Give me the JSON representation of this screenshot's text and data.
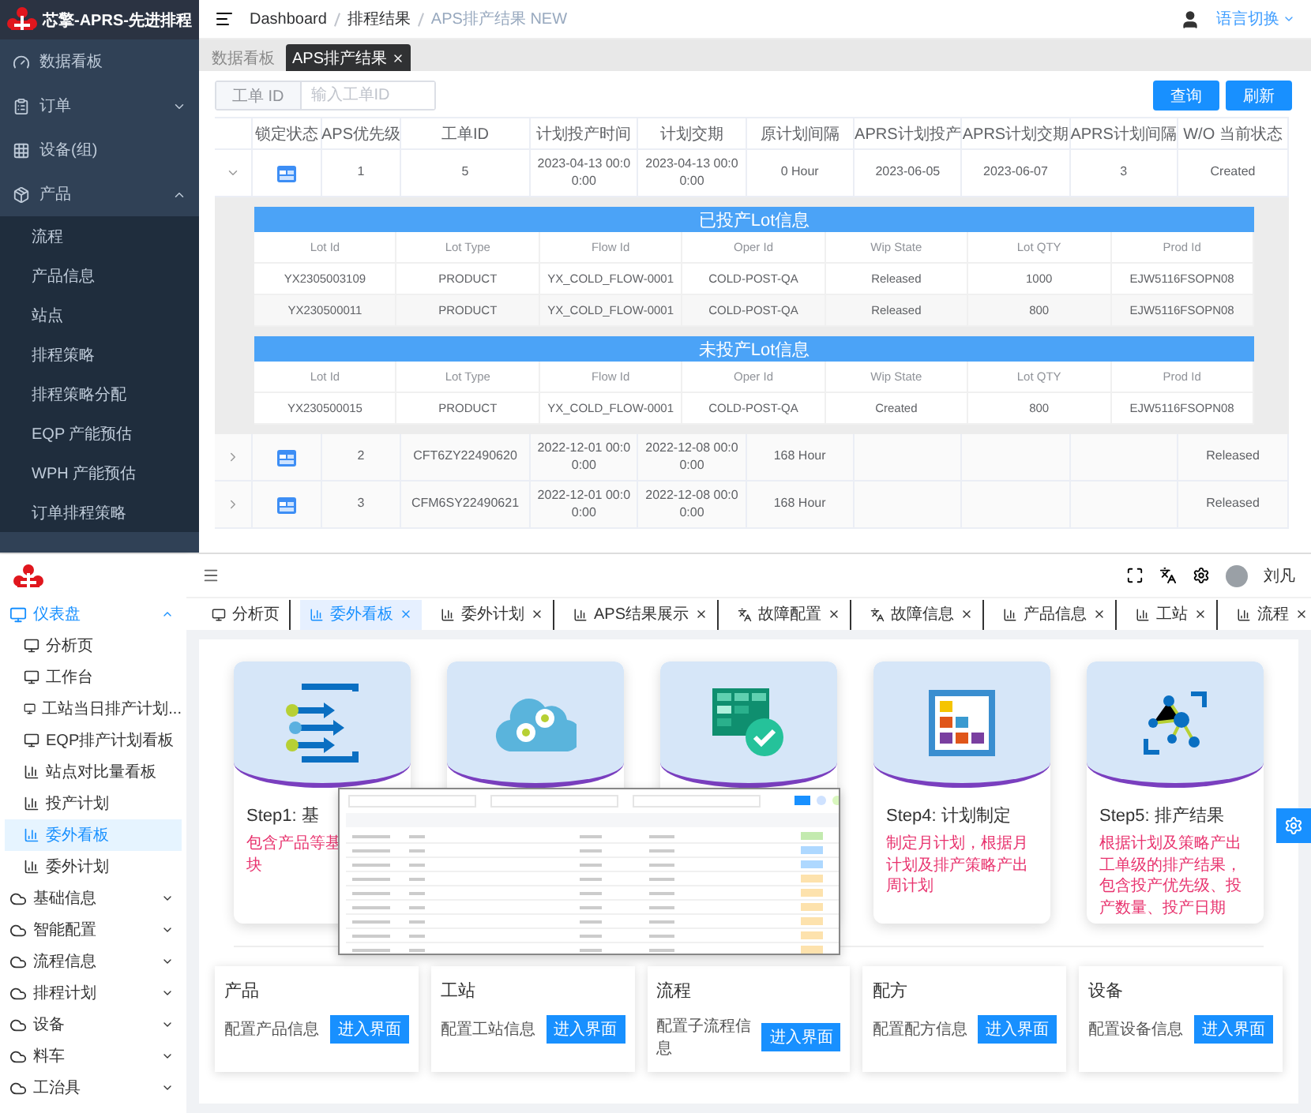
{
  "admin": {
    "app_title": "芯擎-APRS-先进排程",
    "sidebar": [
      {
        "label": "数据看板",
        "kind": "link"
      },
      {
        "label": "订单",
        "kind": "group",
        "expanded": false
      },
      {
        "label": "设备(组)",
        "kind": "link"
      },
      {
        "label": "产品",
        "kind": "group",
        "expanded": true,
        "children": [
          {
            "label": "流程"
          },
          {
            "label": "产品信息"
          },
          {
            "label": "站点"
          },
          {
            "label": "排程策略"
          },
          {
            "label": "排程策略分配"
          },
          {
            "label": "EQP 产能预估"
          },
          {
            "label": "WPH 产能预估"
          },
          {
            "label": "订单排程策略"
          }
        ]
      }
    ],
    "breadcrumb": [
      "Dashboard",
      "排程结果",
      "APS排产结果 NEW"
    ],
    "language": {
      "label": "语言切换",
      "expanded": false
    },
    "tags": [
      {
        "label": "数据看板",
        "selected": false,
        "closable": false
      },
      {
        "label": "APS排产结果",
        "selected": true,
        "closable": true
      }
    ],
    "filter": {
      "label": "工单 ID",
      "placeholder": "输入工单ID"
    },
    "buttons": [
      "查询",
      "刷新"
    ],
    "table": {
      "columns": [
        "锁定状态",
        "APS优先级",
        "工单ID",
        "计划投产时间",
        "计划交期",
        "原计划间隔",
        "APRS计划投产",
        "APRS计划交期",
        "APRS计划间隔",
        "W/O 当前状态"
      ],
      "rows": [
        {
          "expanded": true,
          "cells": [
            null,
            "1",
            "5",
            "2023-04-13 00:00:00",
            "2023-04-13 00:00:00",
            "0 Hour",
            "2023-06-05",
            "2023-06-07",
            "3",
            "Created"
          ],
          "details": [
            {
              "title": "已投产Lot信息",
              "columns": [
                "Lot Id",
                "Lot Type",
                "Flow Id",
                "Oper Id",
                "Wip State",
                "Lot QTY",
                "Prod Id"
              ],
              "rows": [
                [
                  "YX2305003109",
                  "PRODUCT",
                  "YX_COLD_FLOW-0001",
                  "COLD-POST-QA",
                  "Released",
                  "1000",
                  "EJW5116FSOPN08"
                ],
                [
                  "YX230500011",
                  "PRODUCT",
                  "YX_COLD_FLOW-0001",
                  "COLD-POST-QA",
                  "Released",
                  "800",
                  "EJW5116FSOPN08"
                ]
              ]
            },
            {
              "title": "未投产Lot信息",
              "columns": [
                "Lot Id",
                "Lot Type",
                "Flow Id",
                "Oper Id",
                "Wip State",
                "Lot QTY",
                "Prod Id"
              ],
              "rows": [
                [
                  "YX230500015",
                  "PRODUCT",
                  "YX_COLD_FLOW-0001",
                  "COLD-POST-QA",
                  "Created",
                  "800",
                  "EJW5116FSOPN08"
                ]
              ]
            }
          ]
        },
        {
          "expanded": false,
          "cells": [
            null,
            "2",
            "CFT6ZY22490620",
            "2022-12-01 00:00:00",
            "2022-12-08 00:00:00",
            "168 Hour",
            null,
            null,
            null,
            "Released"
          ]
        },
        {
          "expanded": false,
          "cells": [
            null,
            "3",
            "CFM6SY22490621",
            "2022-12-01 00:00:00",
            "2022-12-08 00:00:00",
            "168 Hour",
            null,
            null,
            null,
            "Released"
          ]
        }
      ]
    }
  },
  "mes": {
    "user": "刘凡",
    "sidebar": [
      {
        "label": "仪表盘",
        "expanded": true,
        "children": [
          {
            "label": "分析页",
            "selected": false
          },
          {
            "label": "工作台",
            "selected": false
          },
          {
            "label": "工站当日排产计划...",
            "selected": false
          },
          {
            "label": "EQP排产计划看板",
            "selected": false
          },
          {
            "label": "站点对比量看板",
            "selected": false
          },
          {
            "label": "投产计划",
            "selected": false
          },
          {
            "label": "委外看板",
            "selected": true
          },
          {
            "label": "委外计划",
            "selected": false
          }
        ]
      },
      {
        "label": "基础信息",
        "expanded": false
      },
      {
        "label": "智能配置",
        "expanded": false
      },
      {
        "label": "流程信息",
        "expanded": false
      },
      {
        "label": "排程计划",
        "expanded": false
      },
      {
        "label": "设备",
        "expanded": false
      },
      {
        "label": "料车",
        "expanded": false
      },
      {
        "label": "工治具",
        "expanded": false
      }
    ],
    "tabs": [
      {
        "label": "分析页",
        "selected": false,
        "closable": false
      },
      {
        "label": "委外看板",
        "selected": true,
        "closable": true
      },
      {
        "label": "委外计划",
        "selected": false,
        "closable": true
      },
      {
        "label": "APS结果展示",
        "selected": false,
        "closable": true
      },
      {
        "label": "故障配置",
        "selected": false,
        "closable": true
      },
      {
        "label": "故障信息",
        "selected": false,
        "closable": true
      },
      {
        "label": "产品信息",
        "selected": false,
        "closable": true
      },
      {
        "label": "工站",
        "selected": false,
        "closable": true
      },
      {
        "label": "流程",
        "selected": false,
        "closable": true
      }
    ],
    "steps": [
      {
        "kind": "flow",
        "title": "Step1: 基",
        "desc_lines": [
          "包含产品等基",
          "块"
        ]
      },
      {
        "kind": "cloud"
      },
      {
        "kind": "table"
      },
      {
        "kind": "grid",
        "title": "Step4: 计划制定",
        "desc_lines": [
          "制定月计划，根据月计划及排产策略产出周计划"
        ]
      },
      {
        "kind": "network",
        "title": "Step5: 排产结果",
        "desc_lines": [
          "根据计划及策略产出工单级的排产结果，包含投产优先级、投产数量、投产日期"
        ]
      }
    ],
    "modules": [
      {
        "title": "产品",
        "desc": "配置产品信息",
        "button": "进入界面"
      },
      {
        "title": "工站",
        "desc": "配置工站信息",
        "button": "进入界面"
      },
      {
        "title": "流程",
        "desc": "配置子流程信息",
        "button": "进入界面"
      },
      {
        "title": "配方",
        "desc": "配置配方信息",
        "button": "进入界面"
      },
      {
        "title": "设备",
        "desc": "配置设备信息",
        "button": "进入界面"
      }
    ]
  }
}
